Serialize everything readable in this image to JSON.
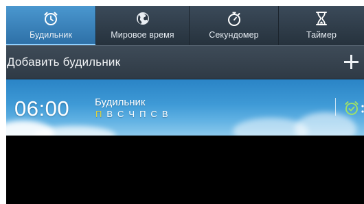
{
  "tabs": [
    {
      "label": "Будильник",
      "icon": "alarm-clock-icon",
      "active": true
    },
    {
      "label": "Мировое время",
      "icon": "globe-icon",
      "active": false
    },
    {
      "label": "Секундомер",
      "icon": "stopwatch-icon",
      "active": false
    },
    {
      "label": "Таймер",
      "icon": "hourglass-icon",
      "active": false
    }
  ],
  "add_bar": {
    "label": "Добавить будильник",
    "icon": "plus-icon"
  },
  "alarm": {
    "time": "06:00",
    "name": "Будильник",
    "days": [
      {
        "letter": "П",
        "active": true
      },
      {
        "letter": "В",
        "active": false
      },
      {
        "letter": "С",
        "active": false
      },
      {
        "letter": "Ч",
        "active": false
      },
      {
        "letter": "П",
        "active": false
      },
      {
        "letter": "С",
        "active": false
      },
      {
        "letter": "В",
        "active": false
      }
    ],
    "enabled": true,
    "toggle_icon": "alarm-on-icon"
  },
  "colors": {
    "active_tab": "#3a86c2",
    "active_day": "#e0d43c",
    "alarm_icon": "#9ee06a",
    "background": "#000000"
  }
}
